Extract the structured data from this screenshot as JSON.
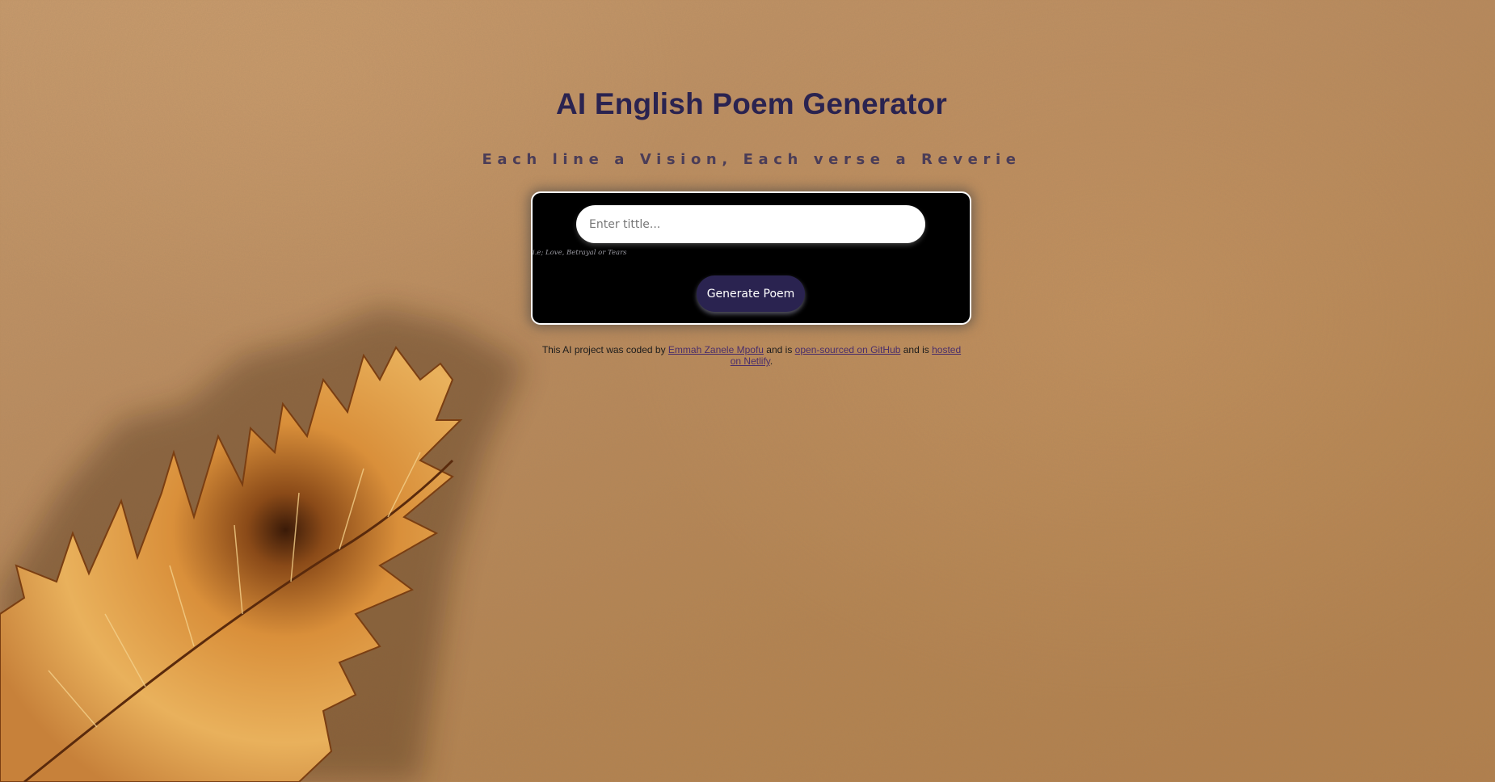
{
  "header": {
    "title": "AI English Poem Generator",
    "subtitle": "Each line a Vision, Each verse a Reverie"
  },
  "form": {
    "input_placeholder": "Enter tittle...",
    "input_value": "",
    "hint": "i.e; Love, Betrayal or Tears",
    "submit_label": "Generate Poem"
  },
  "footer": {
    "text_prefix": "This AI project was coded by ",
    "author_link": "Emmah Zanele Mpofu",
    "text_mid_1": " and is ",
    "github_link": "open-sourced on GitHub",
    "text_mid_2": " and is ",
    "netlify_link": "hosted on Netlify",
    "text_suffix": "."
  },
  "colors": {
    "accent": "#2a2350",
    "background": "#b98a5c",
    "card": "#000000",
    "feather": "#d9953f"
  },
  "icons": {
    "background_decoration": "feather-illustration"
  }
}
